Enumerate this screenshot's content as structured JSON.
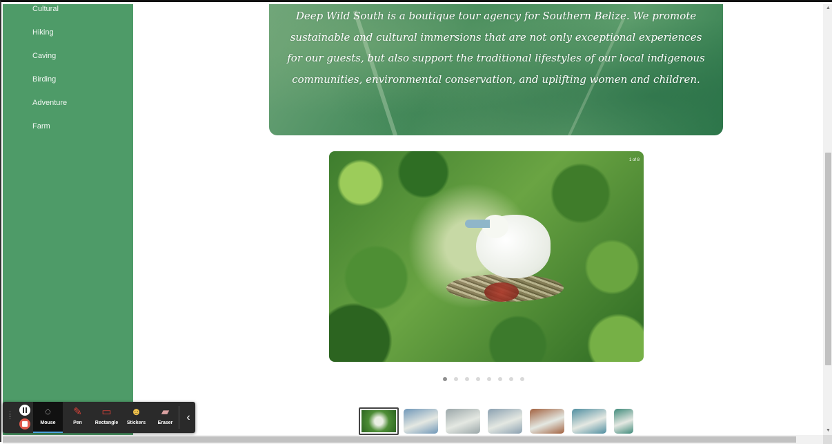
{
  "sidebar": {
    "items": [
      {
        "label": "Cultural"
      },
      {
        "label": "Hiking"
      },
      {
        "label": "Caving"
      },
      {
        "label": "Birding"
      },
      {
        "label": "Adventure"
      },
      {
        "label": "Farm"
      }
    ],
    "color": "#4e9b68"
  },
  "hero": {
    "text": "Deep Wild South is a boutique tour agency for Southern Belize. We promote sustainable and cultural immersions that are not only exceptional experiences for our guests, but also support the traditional lifestyles of our local indigenous communities, environmental conservation, and uplifting women and children."
  },
  "slideshow": {
    "counter": "1 of 8",
    "current_index": 1,
    "total": 8
  },
  "thumbnails": {
    "colors": [
      "#5c9444",
      "#6f97b8",
      "#9aa6a8",
      "#8aa0b0",
      "#a2613f",
      "#4f8ea0",
      "#3f8a7a"
    ]
  },
  "recorder": {
    "tools": [
      {
        "label": "Mouse",
        "icon": "mouse-cursor-icon"
      },
      {
        "label": "Pen",
        "icon": "pen-icon"
      },
      {
        "label": "Rectangle",
        "icon": "rectangle-icon"
      },
      {
        "label": "Stickers",
        "icon": "sticker-icon"
      },
      {
        "label": "Eraser",
        "icon": "eraser-icon"
      }
    ],
    "active_tool": "Mouse",
    "accent": "#4da3e0"
  }
}
